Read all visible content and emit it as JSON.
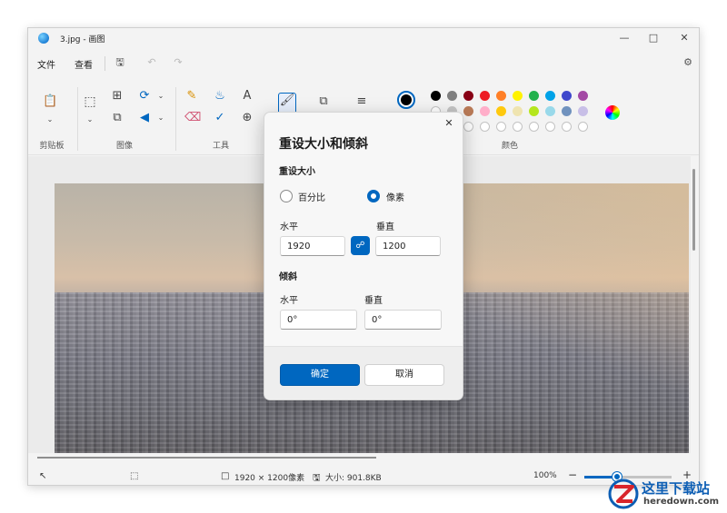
{
  "window": {
    "title": "3.jpg - 画图"
  },
  "menu": {
    "file": "文件",
    "view": "查看"
  },
  "ribbon": {
    "groups": {
      "clipboard": "剪贴板",
      "image": "图像",
      "tools": "工具",
      "colors": "颜色"
    },
    "tool_text_glyph": "A",
    "colors": {
      "row1": [
        "#000000",
        "#7f7f7f",
        "#880015",
        "#ed1c24",
        "#ff7f27",
        "#fff200",
        "#22b14c",
        "#00a2e8",
        "#3f48cc",
        "#a349a4"
      ],
      "row2": [
        "#ffffff",
        "#c3c3c3",
        "#b97a57",
        "#ffaec9",
        "#ffc90e",
        "#efe4b0",
        "#b5e61d",
        "#99d9ea",
        "#7092be",
        "#c8bfe7"
      ],
      "current": "#000000"
    }
  },
  "dialog": {
    "title": "重设大小和倾斜",
    "resize_label": "重设大小",
    "percent_label": "百分比",
    "pixel_label": "像素",
    "selected_unit": "像素",
    "horizontal_label": "水平",
    "vertical_label": "垂直",
    "width_value": "1920",
    "height_value": "1200",
    "skew_label": "倾斜",
    "skew_horizontal_label": "水平",
    "skew_vertical_label": "垂直",
    "skew_h_value": "0°",
    "skew_v_value": "0°",
    "ok_label": "确定",
    "cancel_label": "取消"
  },
  "status": {
    "dimensions": "1920 × 1200像素",
    "file_size": "大小: 901.8KB",
    "zoom": "100%",
    "zoom_fraction": 0.38
  },
  "watermark": {
    "cn": "这里下载站",
    "en": "heredown.com"
  }
}
